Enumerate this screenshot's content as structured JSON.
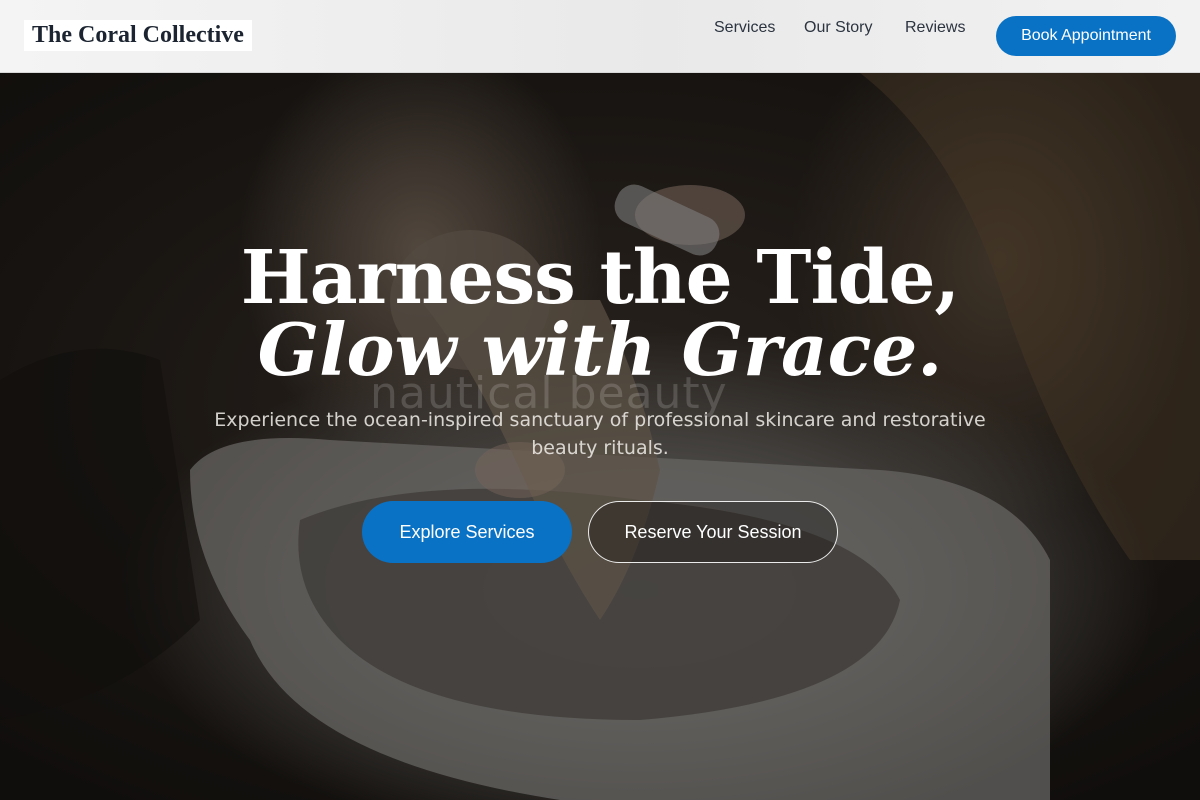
{
  "header": {
    "logo": "The Coral Collective",
    "nav": {
      "services": "Services",
      "story": "Our Story",
      "reviews": "Reviews"
    },
    "book_button": "Book Appointment"
  },
  "hero": {
    "headline_line1": "Harness the Tide,",
    "headline_line2": "Glow with Grace.",
    "watermark": "nautical beauty",
    "subtitle": "Experience the ocean-inspired sanctuary of professional skincare and restorative beauty rituals.",
    "primary_button": "Explore Services",
    "secondary_button": "Reserve Your Session"
  },
  "colors": {
    "accent": "#0a72c4",
    "header_bg": "#f0f0f0",
    "text_dark": "#2c3440",
    "text_light": "#ffffff"
  }
}
